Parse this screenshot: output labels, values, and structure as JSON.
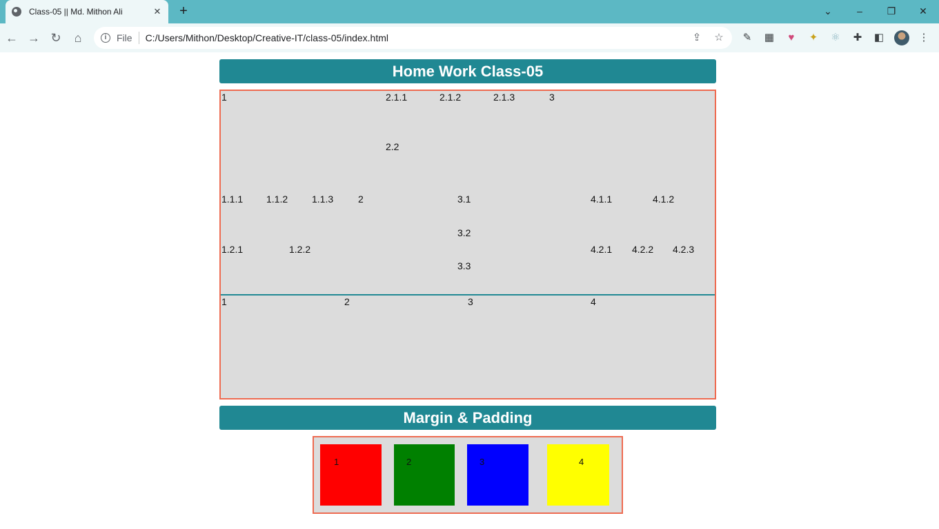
{
  "browser": {
    "tab_title": "Class-05 || Md. Mithon Ali",
    "address_scheme": "File",
    "address_url": "C:/Users/Mithon/Desktop/Creative-IT/class-05/index.html"
  },
  "page": {
    "heading1": "Home Work Class-05",
    "heading2": "Margin & Padding",
    "grid": {
      "row1": {
        "left": "1",
        "middle_top": [
          "2.1.1",
          "2.1.2",
          "2.1.3"
        ],
        "middle_bottom": "2.2",
        "right": "3"
      },
      "row2": {
        "block1_top": [
          "1.1.1",
          "1.1.2",
          "1.1.3"
        ],
        "block1_bottom": [
          "1.2.1",
          "1.2.2"
        ],
        "block2": "2",
        "block3": [
          "3.1",
          "3.2",
          "3.3"
        ],
        "block4_top": [
          "4.1.1",
          "4.1.2"
        ],
        "block4_bottom": [
          "4.2.1",
          "4.2.2",
          "4.2.3"
        ]
      },
      "row3": [
        "1",
        "2",
        "3",
        "4"
      ]
    },
    "squares": [
      {
        "label": "1",
        "color": "#ff0000"
      },
      {
        "label": "2",
        "color": "#008000"
      },
      {
        "label": "3",
        "color": "#0000ff"
      },
      {
        "label": "4",
        "color": "#ffff00"
      }
    ],
    "colors": {
      "heading_bg": "#208893",
      "outline": "#ee6a50",
      "cell_bg": "#dcdcdc"
    }
  }
}
